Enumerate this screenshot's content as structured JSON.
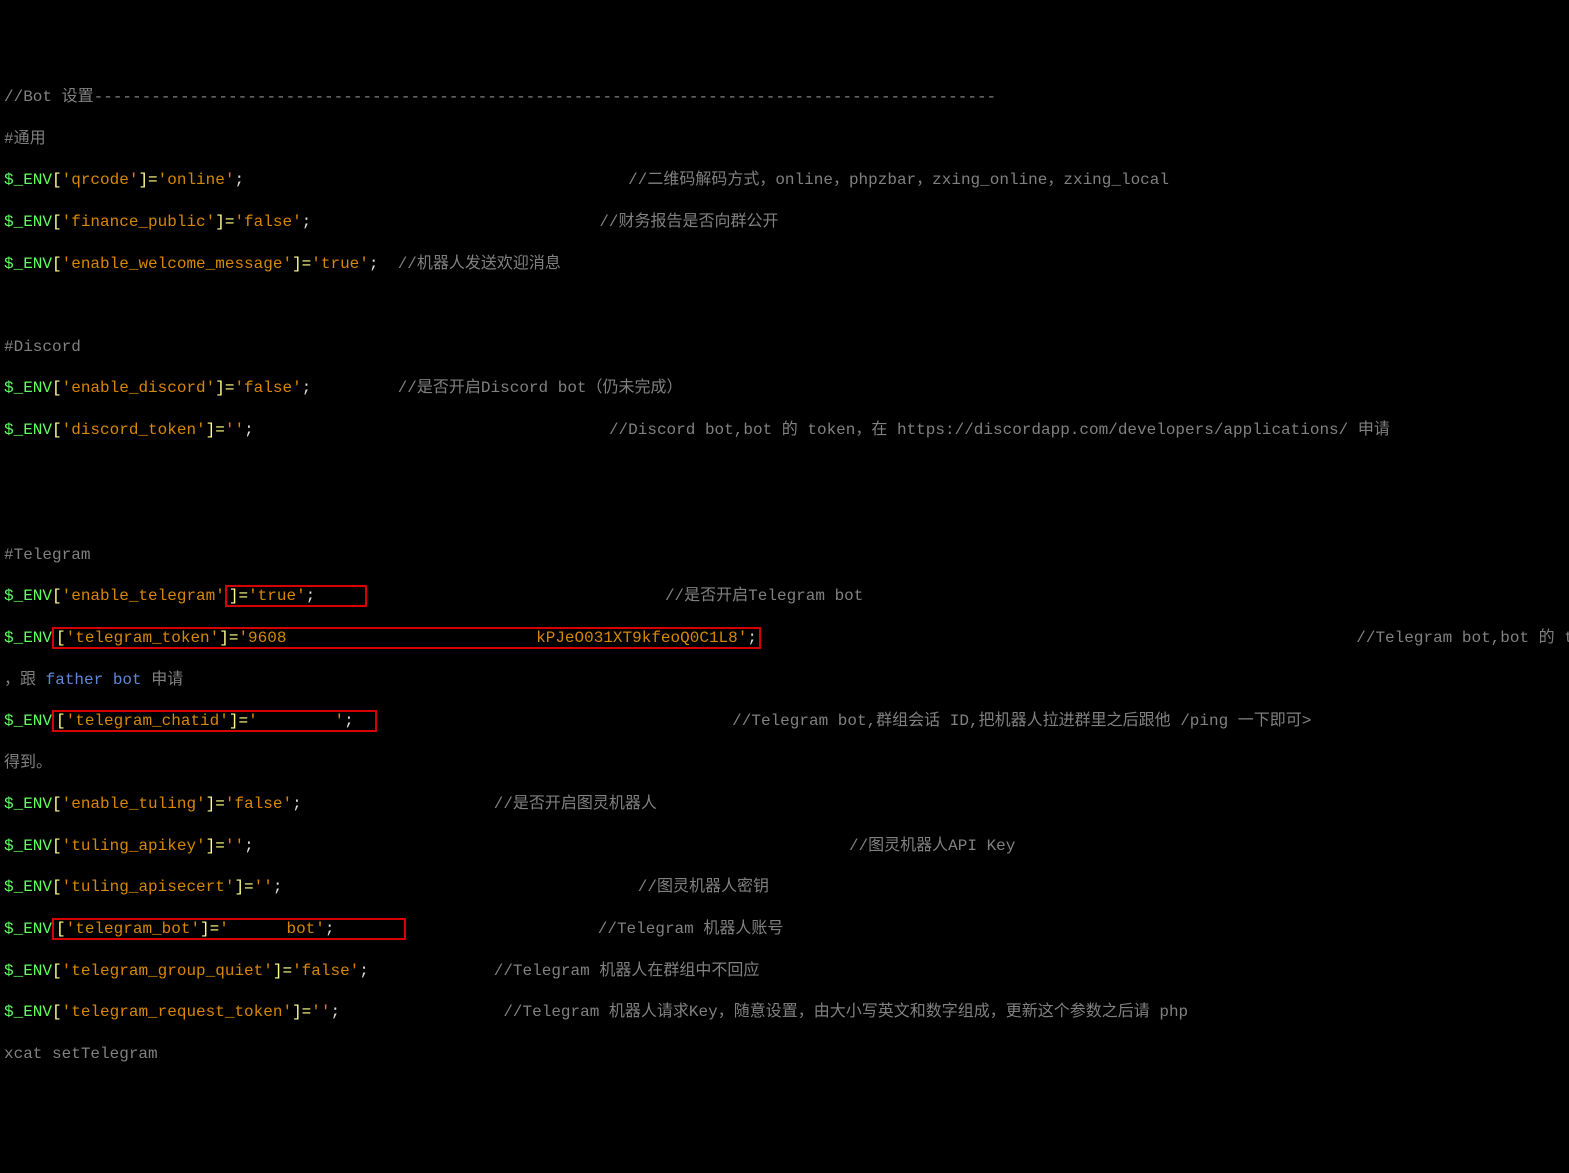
{
  "header": {
    "comment_bot": "//Bot 设置----------------------------------------------------------------------------------------------",
    "section_common": "#通用",
    "section_discord": "#Discord",
    "section_telegram": "#Telegram"
  },
  "env": "$_ENV",
  "qrcode": {
    "key": "'qrcode'",
    "val": "'online'",
    "comment": "//二维码解码方式，online，phpzbar，zxing_online，zxing_local"
  },
  "finance": {
    "key": "'finance_public'",
    "val": "'false'",
    "comment": "//财务报告是否向群公开"
  },
  "welcome": {
    "key": "'enable_welcome_message'",
    "val": "'true'",
    "comment": "//机器人发送欢迎消息"
  },
  "en_disc": {
    "key": "'enable_discord'",
    "val": "'false'",
    "comment": "//是否开启Discord bot（仍未完成）"
  },
  "disc_tok": {
    "key": "'discord_token'",
    "val": "''",
    "comment": "//Discord bot,bot 的 token，在 https://discordapp.com/developers/applications/ 申请"
  },
  "en_tg": {
    "key": "'enable_telegram'",
    "val": "'true'",
    "comment": "//是否开启Telegram bot",
    "box_frag": "]="
  },
  "tg_tok": {
    "key": "'telegram_token'",
    "open": "[",
    "eq": "]=",
    "v1": "'9608",
    "v2": "kPJeO031XT9kfeoQ0C1L8'",
    "semi": ";",
    "comment": "//Telegram bot,bot 的 toker"
  },
  "tg_tok2": {
    "prefix": "，跟 ",
    "link": "father bot",
    "suffix": " 申请"
  },
  "tg_chat": {
    "key": "'telegram_chatid'",
    "open": "[",
    "eq": "]=",
    "val": "'        '",
    "semi": ";",
    "comment": "//Telegram bot,群组会话 ID,把机器人拉进群里之后跟他 /ping 一下即可>"
  },
  "tg_chat2": "得到。",
  "en_tul": {
    "key": "'enable_tuling'",
    "val": "'false'",
    "comment": "//是否开启图灵机器人"
  },
  "tul_api": {
    "key": "'tuling_apikey'",
    "val": "''",
    "comment": "//图灵机器人API Key"
  },
  "tul_sec": {
    "key": "'tuling_apisecert'",
    "val": "''",
    "comment": "//图灵机器人密钥"
  },
  "tg_bot": {
    "key": "'telegram_bot'",
    "open": "[",
    "eq": "]=",
    "v1": "'",
    "v2": "bot'",
    "semi": ";",
    "comment": "//Telegram 机器人账号"
  },
  "tg_quiet": {
    "key": "'telegram_group_quiet'",
    "val": "'false'",
    "comment": "//Telegram 机器人在群组中不回应"
  },
  "tg_req": {
    "key": "'telegram_request_token'",
    "val": "''",
    "comment": "//Telegram 机器人请求Key，随意设置，由大小写英文和数字组成，更新这个参数之后请 php"
  },
  "tg_req2": "xcat setTelegram",
  "sp": {
    "a": "                                        ",
    "b": "                              ",
    "c": "  ",
    "d": "         ",
    "e": "                                     ",
    "f": "                               ",
    "g": "               ",
    "h": "             ",
    "i": "                                                              ",
    "j": "                 ",
    "k": "                          ",
    "l": "     ",
    "m": "                    ",
    "n": "       ",
    "o": "          ",
    "p": "      "
  }
}
